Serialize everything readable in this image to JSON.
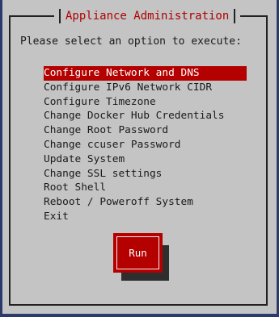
{
  "dialog": {
    "title": "Appliance Administration",
    "prompt": "Please select an option to execute:"
  },
  "menu": {
    "selected_index": 0,
    "items": [
      {
        "label": "Configure Network and DNS"
      },
      {
        "label": "Configure IPv6 Network CIDR"
      },
      {
        "label": "Configure Timezone"
      },
      {
        "label": "Change Docker Hub Credentials"
      },
      {
        "label": "Change Root Password"
      },
      {
        "label": "Change ccuser Password"
      },
      {
        "label": "Update System"
      },
      {
        "label": "Change SSL settings"
      },
      {
        "label": "Root Shell"
      },
      {
        "label": "Reboot / Poweroff System"
      },
      {
        "label": "Exit"
      }
    ]
  },
  "buttons": {
    "run_label": "Run"
  },
  "colors": {
    "background": "#c4c4c4",
    "accent": "#b50000",
    "title_text": "#b00000",
    "screen_edge": "#2b3a6a"
  }
}
